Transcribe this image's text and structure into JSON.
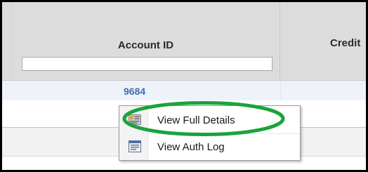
{
  "grid": {
    "columns": [
      {
        "label": "Account ID",
        "filter_value": ""
      },
      {
        "label": "Credit"
      }
    ],
    "rows": [
      {
        "account_id": "9684"
      }
    ]
  },
  "context_menu": {
    "items": [
      {
        "label": "View Full Details",
        "icon": "details-card-icon",
        "highlighted": true
      },
      {
        "label": "View Auth Log",
        "icon": "log-window-icon",
        "highlighted": false
      }
    ]
  },
  "colors": {
    "header_bg": "#dcdcdc",
    "link": "#3e6da8",
    "row_highlight": "#eef3f9",
    "annotation": "#1aa33c"
  }
}
